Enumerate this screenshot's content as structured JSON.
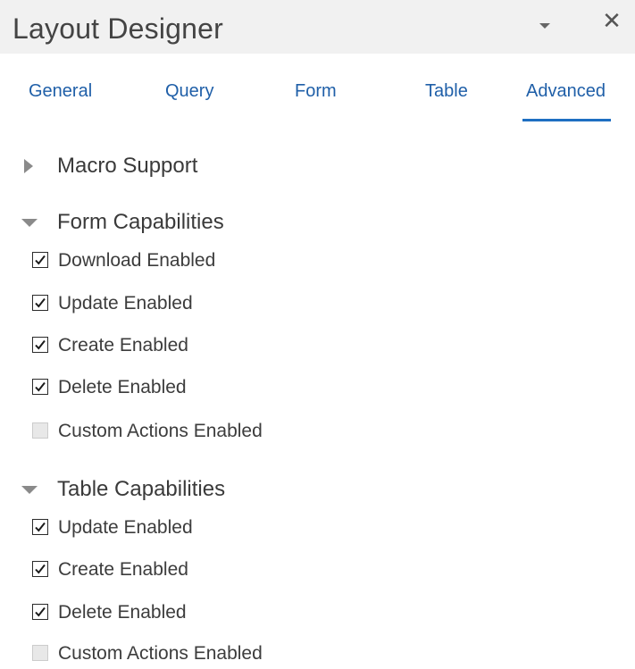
{
  "window": {
    "title": "Layout Designer",
    "dropdown_icon": "caret-down-icon",
    "close_label": "✕"
  },
  "tabs": [
    {
      "label": "General",
      "active": false
    },
    {
      "label": "Query",
      "active": false
    },
    {
      "label": "Form",
      "active": false
    },
    {
      "label": "Table",
      "active": false
    },
    {
      "label": "Advanced",
      "active": true
    }
  ],
  "sections": {
    "macro": {
      "label": "Macro Support",
      "expanded": false
    },
    "form": {
      "label": "Form Capabilities",
      "expanded": true,
      "options": [
        {
          "label": "Download Enabled",
          "checked": true
        },
        {
          "label": "Update Enabled",
          "checked": true
        },
        {
          "label": "Create Enabled",
          "checked": true
        },
        {
          "label": "Delete Enabled",
          "checked": true
        },
        {
          "label": "Custom Actions Enabled",
          "checked": false
        }
      ]
    },
    "table": {
      "label": "Table Capabilities",
      "expanded": true,
      "options": [
        {
          "label": "Update Enabled",
          "checked": true
        },
        {
          "label": "Create Enabled",
          "checked": true
        },
        {
          "label": "Delete Enabled",
          "checked": true
        },
        {
          "label": "Custom Actions Enabled",
          "checked": false
        }
      ]
    }
  },
  "colors": {
    "accent": "#1e6fc2",
    "tab_text": "#1f5fa8",
    "titlebar_bg": "#f1f1f1"
  }
}
